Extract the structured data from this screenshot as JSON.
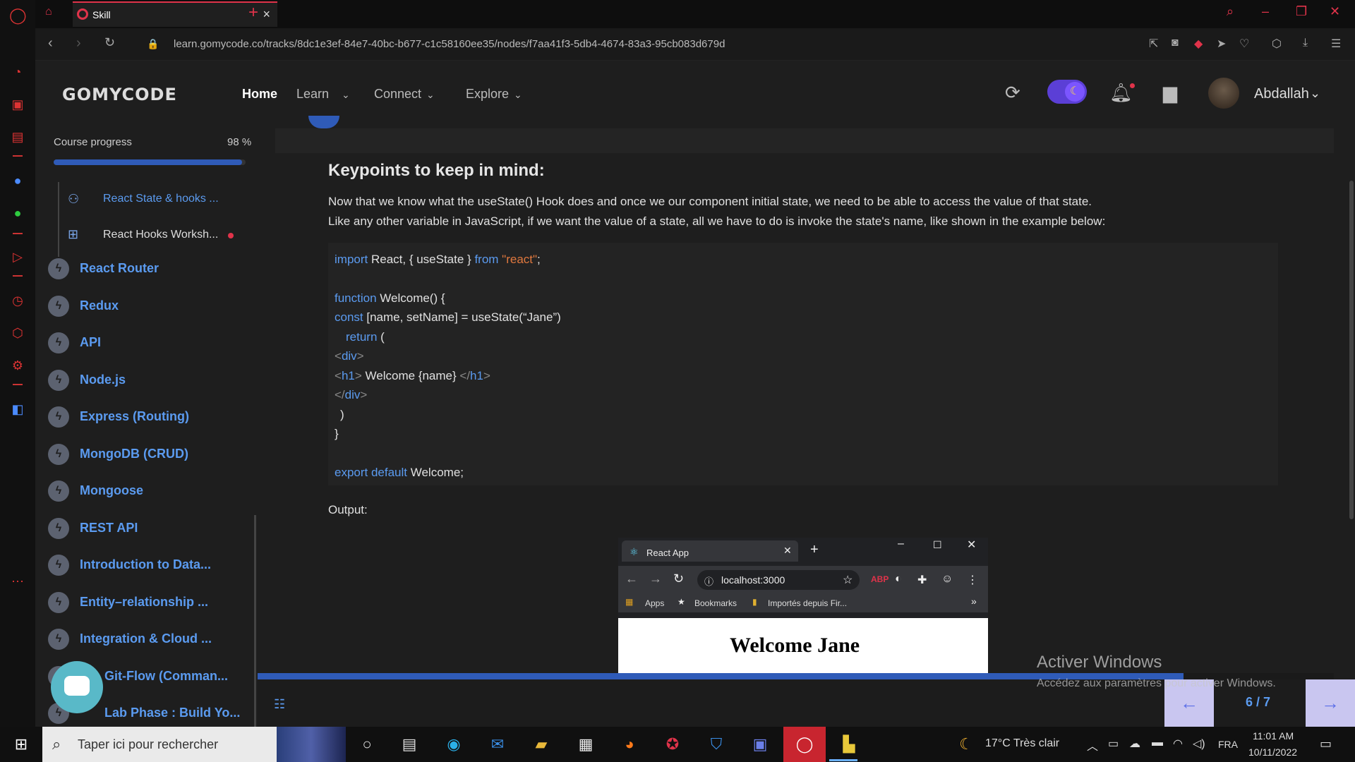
{
  "browser": {
    "tab_title": "Skill",
    "url": "learn.gomycode.co/tracks/8dc1e3ef-84e7-40bc-b677-c1c58160ee35/nodes/f7aa41f3-5db4-4674-83a3-95cb083d679d"
  },
  "header": {
    "logo": "GOMYCODE",
    "nav": [
      {
        "label": "Home",
        "active": true
      },
      {
        "label": "Learn",
        "active": false
      },
      {
        "label": "Connect",
        "active": false
      },
      {
        "label": "Explore",
        "active": false
      }
    ],
    "username": "Abdallah",
    "accent_color": "#5b3fd6"
  },
  "sidebar": {
    "progress_label": "Course progress",
    "progress_value": "98 %",
    "progress_fraction": 0.98,
    "sub_items": [
      {
        "label": "React State & hooks ...",
        "icon": "people-icon"
      },
      {
        "label": "React Hooks Worksh...",
        "icon": "workshop-icon"
      }
    ],
    "modules": [
      "React Router",
      "Redux",
      "API",
      "Node.js",
      "Express (Routing)",
      "MongoDB (CRUD)",
      "Mongoose",
      "REST API",
      "Introduction to Data...",
      "Entity–relationship ...",
      "Integration & Cloud ...",
      "Git-Flow (Comman...",
      "Lab Phase : Build Yo..."
    ]
  },
  "content": {
    "title": "Keypoints to keep in mind:",
    "para1": "Now that we know what the useState() Hook does and once we our component initial state, we need to be able to access the value of that state.",
    "para2": "Like any other variable in JavaScript, if we want the value of a state, all we have to do is invoke the state's name, like shown in the example below:",
    "code": {
      "l1_kw": "import",
      "l1_a": " React, { useState } ",
      "l1_kw2": "from",
      "l1_str": " \"react\"",
      "l1_end": ";",
      "l2_kw": "function",
      "l2_a": " Welcome() {",
      "l3_kw": "const",
      "l3_a": " [name, setName] = useState(“Jane”)",
      "l4_kw": "return",
      "l4_a": " (",
      "l5_t1": "<",
      "l5_kw": "div",
      "l5_t2": ">",
      "l6_t1": "<",
      "l6_kw": "h1",
      "l6_t2": ">",
      "l6_a": " Welcome {name} ",
      "l6_t3": "</",
      "l6_kw2": "h1",
      "l6_t4": ">",
      "l7_t1": "</",
      "l7_kw": "div",
      "l7_t2": ">",
      "l8": ")",
      "l9": "}",
      "l10_kw": "export default",
      "l10_a": " Welcome;"
    },
    "output_label": "Output:",
    "screenshot": {
      "tab": "React App",
      "address": "localhost:3000",
      "bookmarks": [
        "Apps",
        "Bookmarks",
        "Importés depuis Fir..."
      ],
      "heading": "Welcome Jane"
    }
  },
  "footer": {
    "page_count": "6 / 7",
    "slide_fraction": 0.86
  },
  "watermark": {
    "title": "Activer Windows",
    "subtitle": "Accédez aux paramètres pour activer Windows."
  },
  "taskbar": {
    "search_placeholder": "Taper ici pour rechercher",
    "weather": "17°C  Très clair",
    "lang": "FRA",
    "time": "11:01 AM",
    "date": "10/11/2022"
  }
}
